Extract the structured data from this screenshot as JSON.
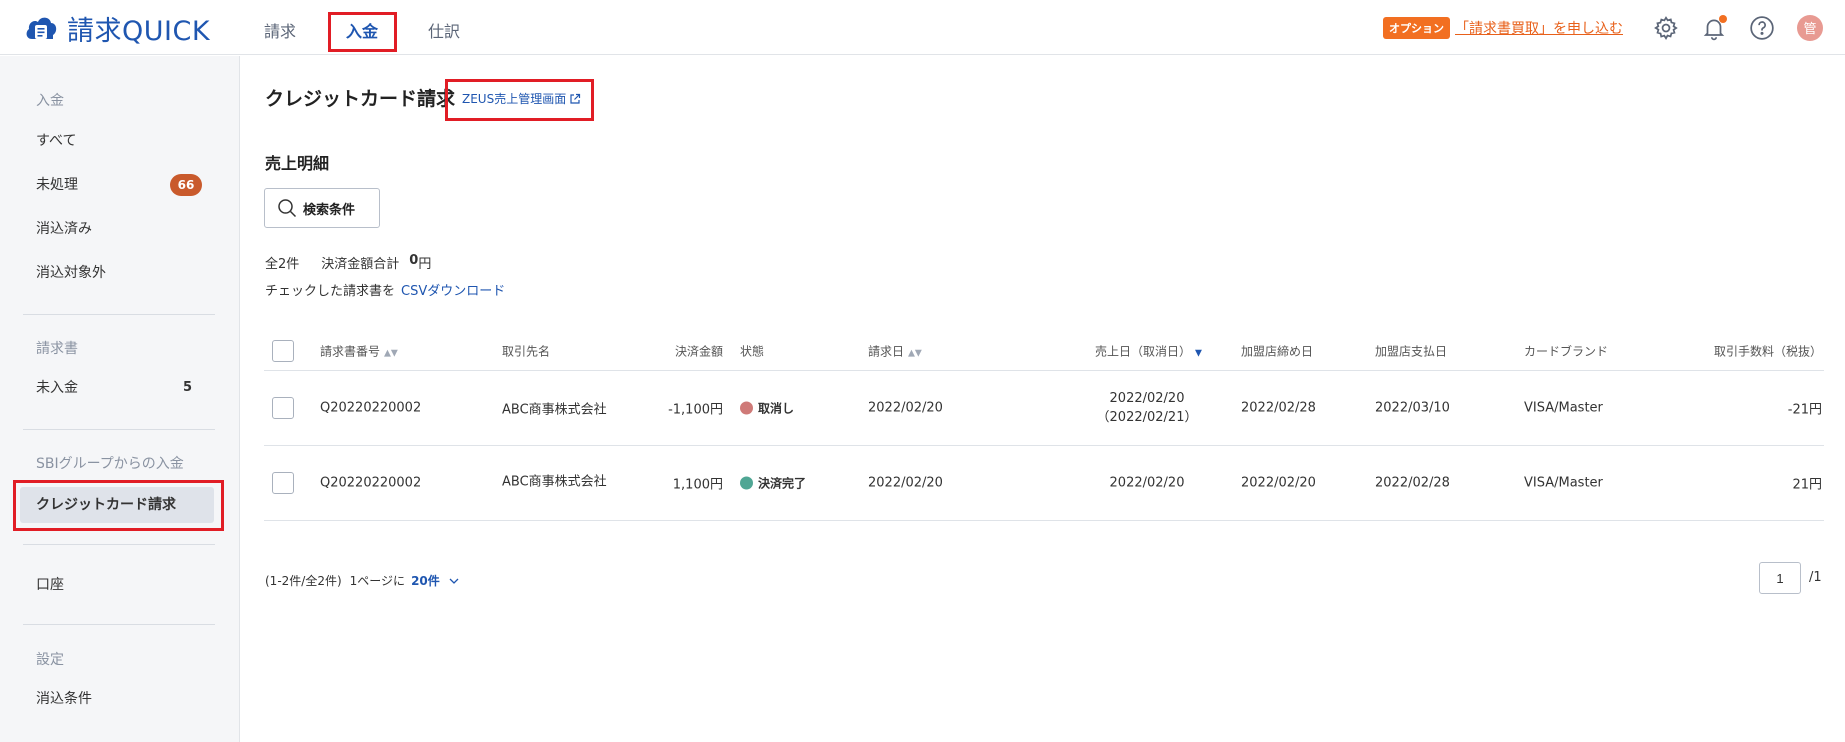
{
  "app": {
    "logo_text": "請求QUICK",
    "brand_color": "#1f56b0"
  },
  "topnav": {
    "items": [
      {
        "label": "請求"
      },
      {
        "label": "入金"
      },
      {
        "label": "仕訳"
      }
    ]
  },
  "header": {
    "option_badge": "オプション",
    "option_link": "「請求書買取」を申し込む",
    "avatar": "管"
  },
  "sidebar": {
    "sections": [
      {
        "title": "入金",
        "items": [
          {
            "label": "すべて"
          },
          {
            "label": "未処理",
            "badge": "66"
          },
          {
            "label": "消込済み"
          },
          {
            "label": "消込対象外"
          }
        ]
      },
      {
        "title": "請求書",
        "items": [
          {
            "label": "未入金",
            "count": "5"
          }
        ]
      },
      {
        "title": "SBIグループからの入金",
        "items": [
          {
            "label": "クレジットカード請求"
          }
        ]
      },
      {
        "title": "",
        "items": [
          {
            "label": "口座"
          }
        ]
      },
      {
        "title": "設定",
        "items": [
          {
            "label": "消込条件"
          }
        ]
      }
    ]
  },
  "main": {
    "title": "クレジットカード請求",
    "ext_link": "ZEUS売上管理画面",
    "section_title": "売上明細",
    "search_button": "検索条件",
    "summary": {
      "total_count": "全2件",
      "amount_label": "決済金額合計",
      "amount_value": "0",
      "amount_unit": "円"
    },
    "csv": {
      "prefix": "チェックした請求書を",
      "link": "CSVダウンロード"
    }
  },
  "table": {
    "columns": [
      "請求書番号",
      "取引先名",
      "決済金額",
      "状態",
      "請求日",
      "売上日（取消日）",
      "加盟店締め日",
      "加盟店支払日",
      "カードブランド",
      "取引手数料（税抜）"
    ],
    "rows": [
      {
        "invoice_no": "Q20220220002",
        "client": "ABC商事株式会社",
        "amount": "-1,100円",
        "status": "取消し",
        "status_color": "#cf7a78",
        "invoice_date": "2022/02/20",
        "sales_date": "2022/02/20",
        "cancel_date": "（2022/02/21）",
        "close_date": "2022/02/28",
        "pay_date": "2022/03/10",
        "brand": "VISA/Master",
        "fee": "-21円"
      },
      {
        "invoice_no": "Q20220220002",
        "client": "ABC商事株式会社",
        "amount": "1,100円",
        "status": "決済完了",
        "status_color": "#4fa694",
        "invoice_date": "2022/02/20",
        "sales_date": "2022/02/20",
        "cancel_date": "",
        "close_date": "2022/02/20",
        "pay_date": "2022/02/28",
        "brand": "VISA/Master",
        "fee": "21円"
      }
    ]
  },
  "pagination": {
    "info": "(1-2件/全2件)",
    "per_page_label": "1ページに",
    "per_page": "20件",
    "current_page": "1",
    "total_pages": "/1"
  }
}
